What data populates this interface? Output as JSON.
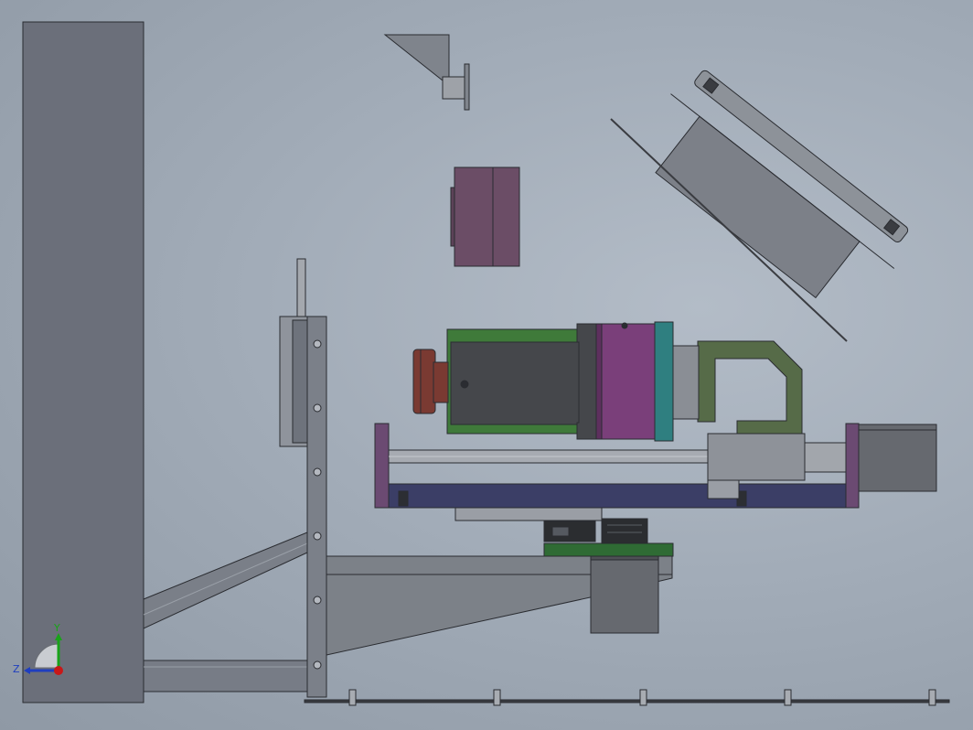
{
  "viewport": {
    "background": "#a3adb9",
    "model_color": "#6b6f78",
    "accent_colors": {
      "motor_body": "#45474b",
      "motor_stripe": "#3f7a3a",
      "coupler_purple": "#7a3f7a",
      "teal_ring": "#2f7f80",
      "knob_red": "#7a3a32",
      "base_navy": "#3b3e66",
      "bracket_green": "#566b48",
      "pcb_green": "#2f6b34",
      "block_purple": "#6b4d66"
    }
  },
  "triad": {
    "x_label": "",
    "y_label": "Y",
    "z_label": "Z",
    "y_color": "#19a319",
    "z_color": "#1f3ebf",
    "x_color": "#c81818"
  }
}
